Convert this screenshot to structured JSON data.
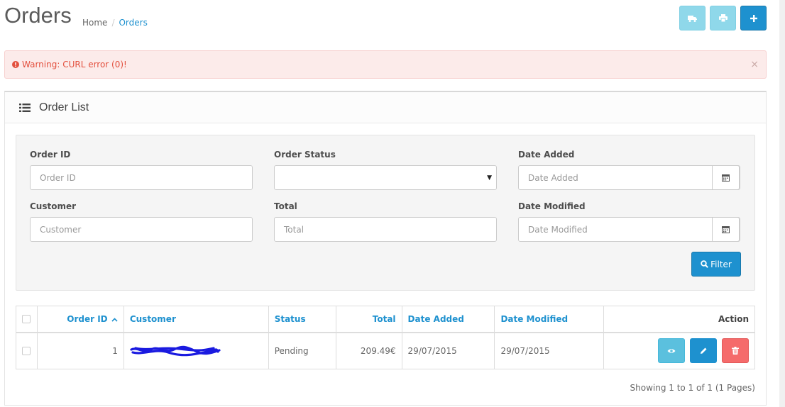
{
  "header": {
    "title": "Orders",
    "breadcrumb": [
      {
        "label": "Home"
      },
      {
        "label": "Orders"
      }
    ],
    "buttons": [
      {
        "icon": "truck-icon",
        "color": "#8fd8ea"
      },
      {
        "icon": "print-icon",
        "color": "#8fd8ea"
      },
      {
        "icon": "plus-icon",
        "color": "#1e91cf"
      }
    ]
  },
  "alert": {
    "text": "Warning: CURL error (0)!",
    "close": "×",
    "color": "#e3503e"
  },
  "panel": {
    "title": "Order List",
    "icon": "list-icon"
  },
  "filters": {
    "order_id": {
      "label": "Order ID",
      "placeholder": "Order ID"
    },
    "order_status": {
      "label": "Order Status",
      "value": ""
    },
    "date_added": {
      "label": "Date Added",
      "placeholder": "Date Added"
    },
    "customer": {
      "label": "Customer",
      "placeholder": "Customer"
    },
    "total": {
      "label": "Total",
      "placeholder": "Total"
    },
    "date_modified": {
      "label": "Date Modified",
      "placeholder": "Date Modified"
    },
    "filter_button": "Filter"
  },
  "table": {
    "columns": {
      "order_id": "Order ID",
      "customer": "Customer",
      "status": "Status",
      "total": "Total",
      "date_added": "Date Added",
      "date_modified": "Date Modified",
      "action": "Action"
    },
    "rows": [
      {
        "order_id": "1",
        "customer": "",
        "status": "Pending",
        "total": "209.49€",
        "date_added": "29/07/2015",
        "date_modified": "29/07/2015"
      }
    ]
  },
  "pagination": {
    "text": "Showing 1 to 1 of 1 (1 Pages)"
  }
}
